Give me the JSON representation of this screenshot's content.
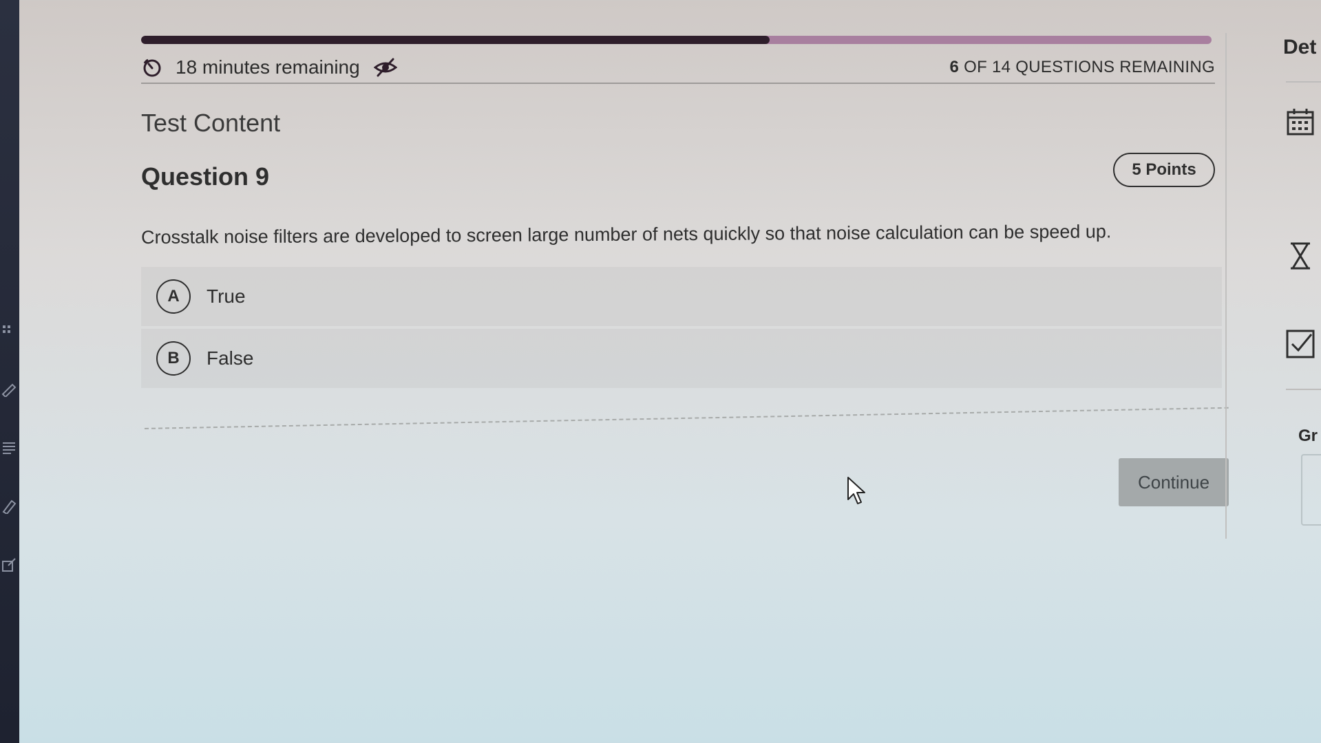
{
  "progress": {
    "fraction": 0.587
  },
  "timer": {
    "text": "18 minutes remaining"
  },
  "questions_remaining": {
    "count": "6",
    "text": " OF 14 QUESTIONS REMAINING"
  },
  "section_title": "Test Content",
  "question": {
    "title": "Question 9",
    "points": "5 Points",
    "text": "Crosstalk noise filters are developed to screen large number of nets quickly so that noise calculation can be speed up."
  },
  "answers": [
    {
      "letter": "A",
      "label": "True"
    },
    {
      "letter": "B",
      "label": "False"
    }
  ],
  "continue_label": "Continue",
  "right_panel": {
    "details_title": "Det",
    "grade_title": "Gr"
  },
  "colors": {
    "progress_fill": "#2e1e2b",
    "progress_track": "#a87f9f",
    "button_bg": "#a4a9aa"
  }
}
